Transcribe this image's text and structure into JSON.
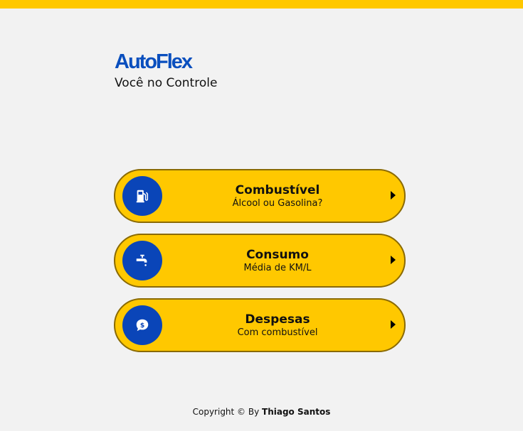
{
  "brand": {
    "title": "AutoFlex",
    "subtitle": "Você no Controle"
  },
  "colors": {
    "accent": "#ffc800",
    "brand_blue": "#0a4fbe",
    "icon_bg": "#0a45b8",
    "background": "#f2f2f2"
  },
  "menu": {
    "items": [
      {
        "title": "Combustível",
        "subtitle": "Álcool ou Gasolina?",
        "icon": "fuel-pump-icon"
      },
      {
        "title": "Consumo",
        "subtitle": "Média de KM/L",
        "icon": "faucet-icon"
      },
      {
        "title": "Despesas",
        "subtitle": "Com combustível",
        "icon": "money-chat-icon"
      }
    ]
  },
  "footer": {
    "prefix": "Copyright © By ",
    "author": "Thiago Santos"
  }
}
